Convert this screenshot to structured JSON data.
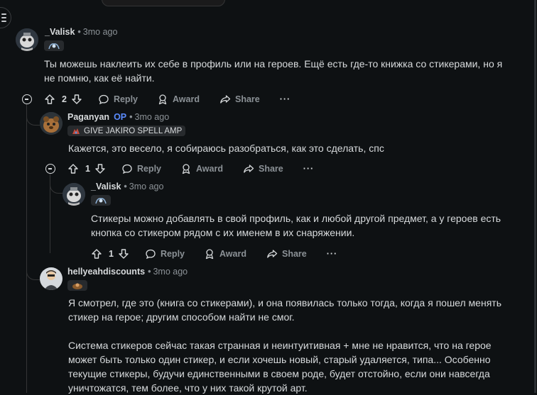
{
  "comments": [
    {
      "username": "_Valisk",
      "time": "3mo ago",
      "body": [
        "Ты можешь наклеить их себе в профиль или на героев. Ещё есть где-то книжка со стикерами, но я не помню, как её найти."
      ],
      "votes": "2",
      "actions": {
        "reply": "Reply",
        "award": "Award",
        "share": "Share",
        "more": "···"
      }
    },
    {
      "username": "Paganyan",
      "op": "OP",
      "time": "3mo ago",
      "flair": "GIVE JAKIRO SPELL AMP",
      "body": [
        "Кажется, это весело, я собираюсь разобраться, как это сделать, спс"
      ],
      "votes": "1",
      "actions": {
        "reply": "Reply",
        "award": "Award",
        "share": "Share",
        "more": "···"
      }
    },
    {
      "username": "_Valisk",
      "time": "3mo ago",
      "body": [
        "Стикеры можно добавлять в свой профиль, как и любой другой предмет, а у героев есть кнопка со стикером рядом с их именем в их снаряжении."
      ],
      "votes": "1",
      "actions": {
        "reply": "Reply",
        "award": "Award",
        "share": "Share",
        "more": "···"
      }
    },
    {
      "username": "hellyeahdiscounts",
      "time": "3mo ago",
      "body": [
        "Я смотрел, где это (книга со стикерами), и она появилась только тогда, когда я пошел менять стикер на герое; другим способом найти не смог.",
        "Система стикеров сейчас такая странная и неинтуитивная + мне не нравится, что на герое может быть только один стикер, и если хочешь новый, старый удаляется, типа... Особенно текущие стикеры, будучи единственными в своем роде, будет отстойно, если они навсегда уничтожатся, тем более, что у них такой крутой арт."
      ]
    }
  ],
  "colors": {
    "background": "#0e1113",
    "text": "#d7dadc",
    "muted": "#8b9196",
    "op": "#5b8cff"
  }
}
